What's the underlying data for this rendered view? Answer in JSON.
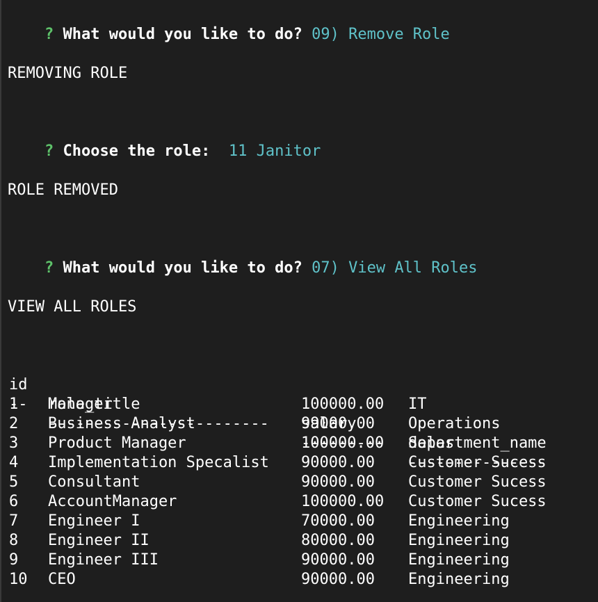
{
  "session": [
    {
      "type": "prompt",
      "mark": "?",
      "question": "What would you like to do?",
      "answer": "09) Remove Role"
    },
    {
      "type": "text",
      "text": "REMOVING ROLE"
    },
    {
      "type": "prompt",
      "mark": "?",
      "question": "Choose the role: ",
      "answer": "11 Janitor"
    },
    {
      "type": "text",
      "text": "ROLE REMOVED"
    },
    {
      "type": "prompt",
      "mark": "?",
      "question": "What would you like to do?",
      "answer": "07) View All Roles"
    },
    {
      "type": "text",
      "text": "VIEW ALL ROLES"
    }
  ],
  "table": {
    "headers": [
      "id",
      "role_title",
      "salary",
      "department_name"
    ],
    "separators": [
      "--",
      "------------------------",
      "---------",
      "---------------"
    ],
    "rows": [
      [
        "1",
        "Manager",
        "100000.00",
        "IT"
      ],
      [
        "2",
        "Business Analyst",
        "99000.00",
        "Operations"
      ],
      [
        "3",
        "Product Manager",
        "100000.00",
        "Sales"
      ],
      [
        "4",
        "Implementation Specalist",
        "90000.00",
        "Customer Sucess"
      ],
      [
        "5",
        "Consultant",
        "90000.00",
        "Customer Sucess"
      ],
      [
        "6",
        "AccountManager",
        "100000.00",
        "Customer Sucess"
      ],
      [
        "7",
        "Engineer I",
        "70000.00",
        "Engineering"
      ],
      [
        "8",
        "Engineer II",
        "80000.00",
        "Engineering"
      ],
      [
        "9",
        "Engineer III",
        "90000.00",
        "Engineering"
      ],
      [
        "10",
        "CEO",
        "90000.00",
        "Engineering"
      ]
    ]
  },
  "colors": {
    "background": "#1e1e1e",
    "prompt_mark": "#5ec26a",
    "answer": "#5fc2c9",
    "text": "#ffffff"
  }
}
